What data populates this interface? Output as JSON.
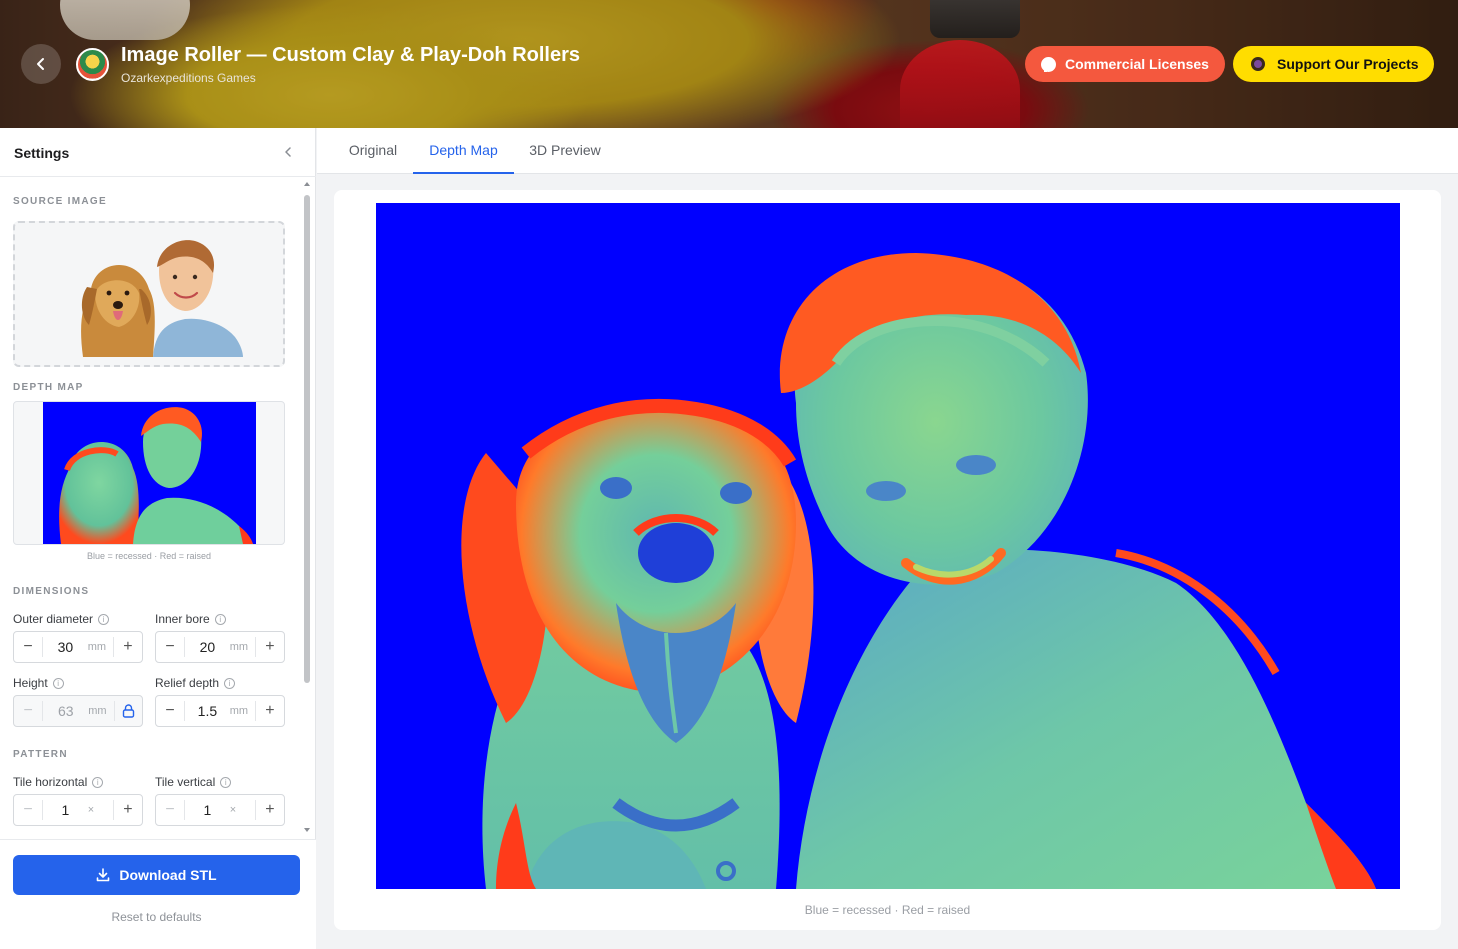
{
  "header": {
    "title": "Image Roller — Custom Clay & Play-Doh Rollers",
    "subtitle": "Ozarkexpeditions Games",
    "commercial_label": "Commercial Licenses",
    "support_label": "Support Our Projects",
    "accent_orange": "#f4583e",
    "accent_yellow": "#ffdd00"
  },
  "sidebar": {
    "title": "Settings",
    "source_image_label": "SOURCE IMAGE",
    "depth_map_label": "DEPTH MAP",
    "depth_caption": "Blue = recessed · Red = raised",
    "dimensions_label": "DIMENSIONS",
    "pattern_label": "PATTERN",
    "fields": {
      "outer_diameter": {
        "label": "Outer diameter",
        "value": "30",
        "unit": "mm"
      },
      "inner_bore": {
        "label": "Inner bore",
        "value": "20",
        "unit": "mm"
      },
      "height": {
        "label": "Height",
        "value": "63",
        "unit": "mm",
        "locked": true
      },
      "relief_depth": {
        "label": "Relief depth",
        "value": "1.5",
        "unit": "mm"
      },
      "tile_horizontal": {
        "label": "Tile horizontal",
        "value": "1",
        "unit": "×"
      },
      "tile_vertical": {
        "label": "Tile vertical",
        "value": "1",
        "unit": "×"
      }
    },
    "download_label": "Download STL",
    "reset_label": "Reset to defaults",
    "primary_color": "#2563eb"
  },
  "tabs": [
    {
      "label": "Original",
      "active": false
    },
    {
      "label": "Depth Map",
      "active": true
    },
    {
      "label": "3D Preview",
      "active": false
    }
  ],
  "viewer": {
    "caption": "Blue = recessed · Red = raised",
    "recessed_color": "#0000ff",
    "raised_color": "#ff3b1a"
  },
  "icons": {
    "back": "chevron-left-icon",
    "collapse": "chevron-left-icon",
    "info": "info-icon",
    "lock": "lock-icon",
    "download": "download-icon"
  }
}
